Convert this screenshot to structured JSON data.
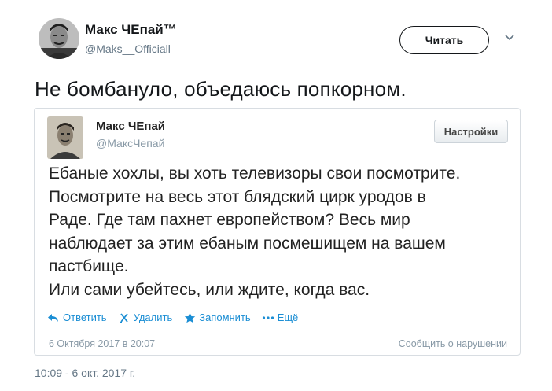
{
  "outer_tweet": {
    "author_name": "Макс ЧЕпай™",
    "author_handle": "@Maks__Officiall",
    "follow_label": "Читать",
    "text": "Не бомбануло, объедаюсь попкорном.",
    "timestamp": "10:09 - 6 окт. 2017 г."
  },
  "embedded_tweet": {
    "author_name": "Макс ЧЕпай",
    "author_handle": "@МаксЧепай",
    "settings_label": "Настройки",
    "lines": [
      "Ебаные хохлы, вы хоть телевизоры свои посмотрите.",
      "Посмотрите на весь этот блядский цирк уродов в",
      "Раде. Где там пахнет европейством? Весь мир",
      "наблюдает за этим ебаным посмешищем на вашем",
      "пастбище.",
      "Или сами убейтесь, или ждите, когда вас."
    ],
    "actions": {
      "reply": "Ответить",
      "delete": "Удалить",
      "favorite": "Запомнить",
      "more": "Ещё"
    },
    "date": "6 Октября 2017 в 20:07",
    "report": "Сообщить о нарушении"
  },
  "icons": {
    "chevron": "chevron-down-icon",
    "reply": "reply-icon",
    "delete": "delete-icon",
    "favorite": "star-icon",
    "more": "more-dots-icon"
  },
  "colors": {
    "link_blue": "#1b8ed4",
    "muted_gray": "#657786",
    "card_border": "#d8dde2",
    "text_dark": "#14171a"
  }
}
